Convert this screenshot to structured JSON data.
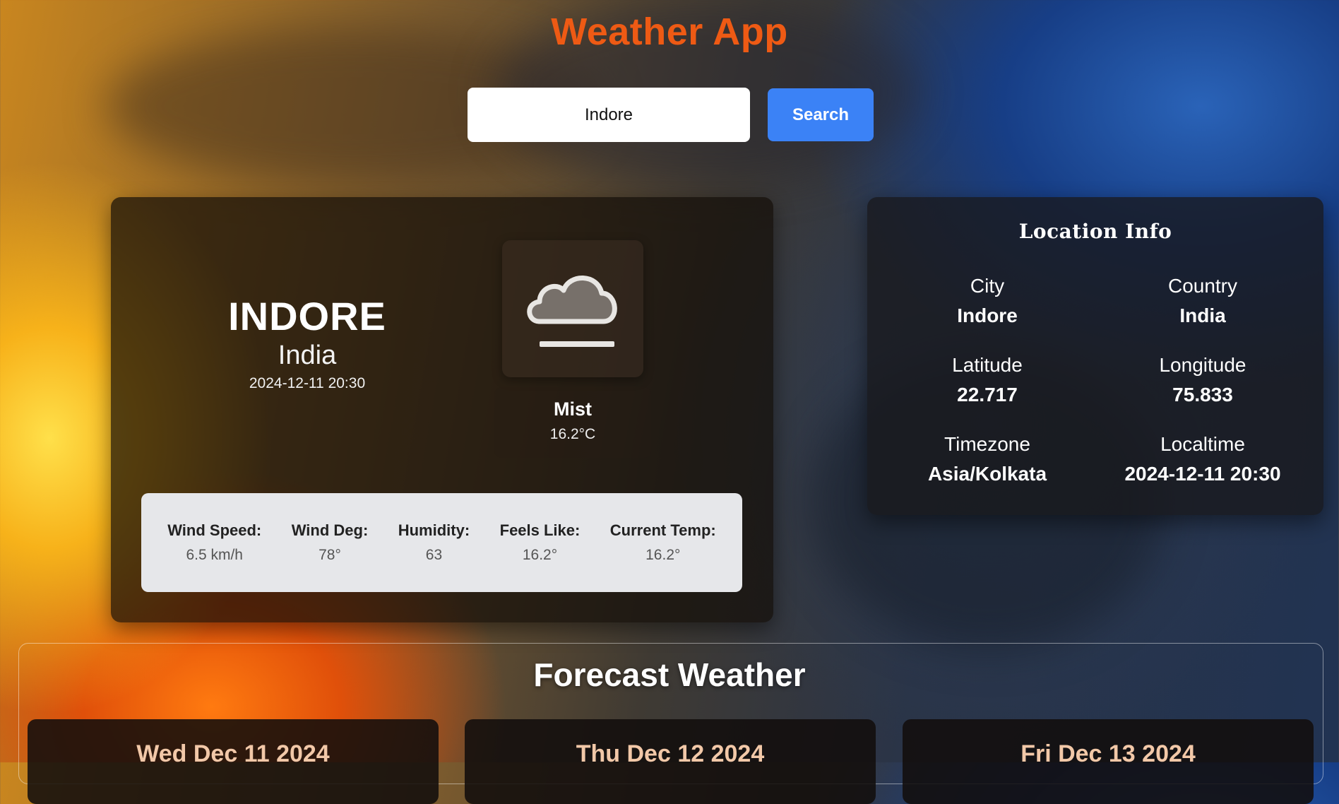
{
  "header": {
    "title": "Weather App"
  },
  "search": {
    "value": "Indore",
    "button_label": "Search"
  },
  "current": {
    "city": "INDORE",
    "country": "India",
    "datetime": "2024-12-11 20:30",
    "condition": "Mist",
    "temp": "16.2°C",
    "icon": "mist-cloud-icon"
  },
  "stats": [
    {
      "label": "Wind Speed:",
      "value": "6.5 km/h"
    },
    {
      "label": "Wind Deg:",
      "value": "78°"
    },
    {
      "label": "Humidity:",
      "value": "63"
    },
    {
      "label": "Feels Like:",
      "value": "16.2°"
    },
    {
      "label": "Current Temp:",
      "value": "16.2°"
    }
  ],
  "location": {
    "title": "Location Info",
    "city_label": "City",
    "city_value": "Indore",
    "country_label": "Country",
    "country_value": "India",
    "lat_label": "Latitude",
    "lat_value": "22.717",
    "lon_label": "Longitude",
    "lon_value": "75.833",
    "tz_label": "Timezone",
    "tz_value": "Asia/Kolkata",
    "localtime_label": "Localtime",
    "localtime_value": "2024-12-11 20:30"
  },
  "forecast": {
    "title": "Forecast Weather",
    "days": [
      {
        "date": "Wed Dec 11 2024"
      },
      {
        "date": "Thu Dec 12 2024"
      },
      {
        "date": "Fri Dec 13 2024"
      }
    ]
  },
  "colors": {
    "title": "#ee5a14",
    "button": "#3b82f6",
    "stats_bg": "#e6e7ea"
  }
}
